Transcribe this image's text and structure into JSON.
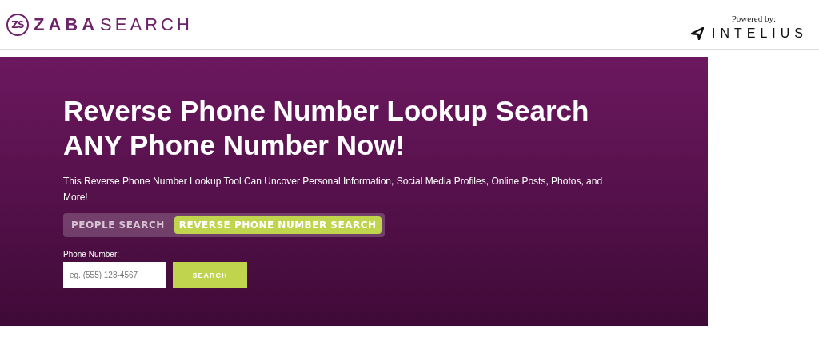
{
  "header": {
    "logo": {
      "mark": "ZS",
      "bold": "ZABA",
      "light": "SEARCH"
    },
    "powered_by": {
      "label": "Powered by:",
      "brand": "INTELIUS"
    }
  },
  "hero": {
    "title_lines": [
      "Reverse Phone Number Lookup Search",
      "ANY Phone Number Now!"
    ],
    "subtitle": "This Reverse Phone Number Lookup Tool Can Uncover Personal Information, Social Media Profiles, Online Posts, Photos, and More!",
    "tabs": [
      {
        "label": "PEOPLE SEARCH",
        "selected": false
      },
      {
        "label": "REVERSE PHONE NUMBER SEARCH",
        "selected": true
      }
    ],
    "field": {
      "label": "Phone Number:",
      "placeholder": "eg. (555) 123-4567"
    },
    "button": "SEARCH"
  }
}
